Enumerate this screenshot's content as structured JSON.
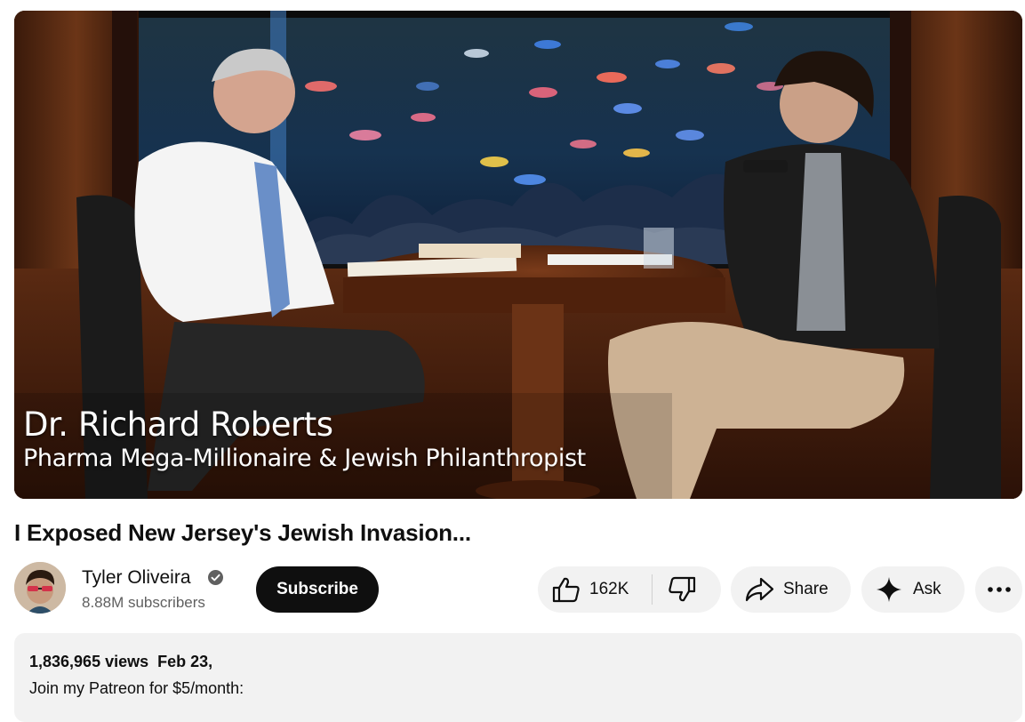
{
  "player": {
    "lower_third_name": "Dr. Richard Roberts",
    "lower_third_role": "Pharma Mega-Millionaire & Jewish Philanthropist"
  },
  "video": {
    "title": "I Exposed New Jersey's Jewish Invasion..."
  },
  "channel": {
    "name": "Tyler Oliveira",
    "subscribers": "8.88M subscribers",
    "verified_icon": "check-circle-icon",
    "subscribe_label": "Subscribe"
  },
  "actions": {
    "like_count": "162K",
    "like_icon": "thumbs-up-icon",
    "dislike_icon": "thumbs-down-icon",
    "share_label": "Share",
    "share_icon": "share-arrow-icon",
    "ask_label": "Ask",
    "ask_icon": "sparkle-icon",
    "more_icon": "more-horizontal-icon"
  },
  "description": {
    "views": "1,836,965 views",
    "date": "Feb 23,",
    "text": "Join my Patreon for $5/month:"
  },
  "colors": {
    "page_background": "#ffffff",
    "pill_background": "#f2f2f2",
    "subscribe_background": "#0f0f0f",
    "secondary_text": "#606060"
  }
}
